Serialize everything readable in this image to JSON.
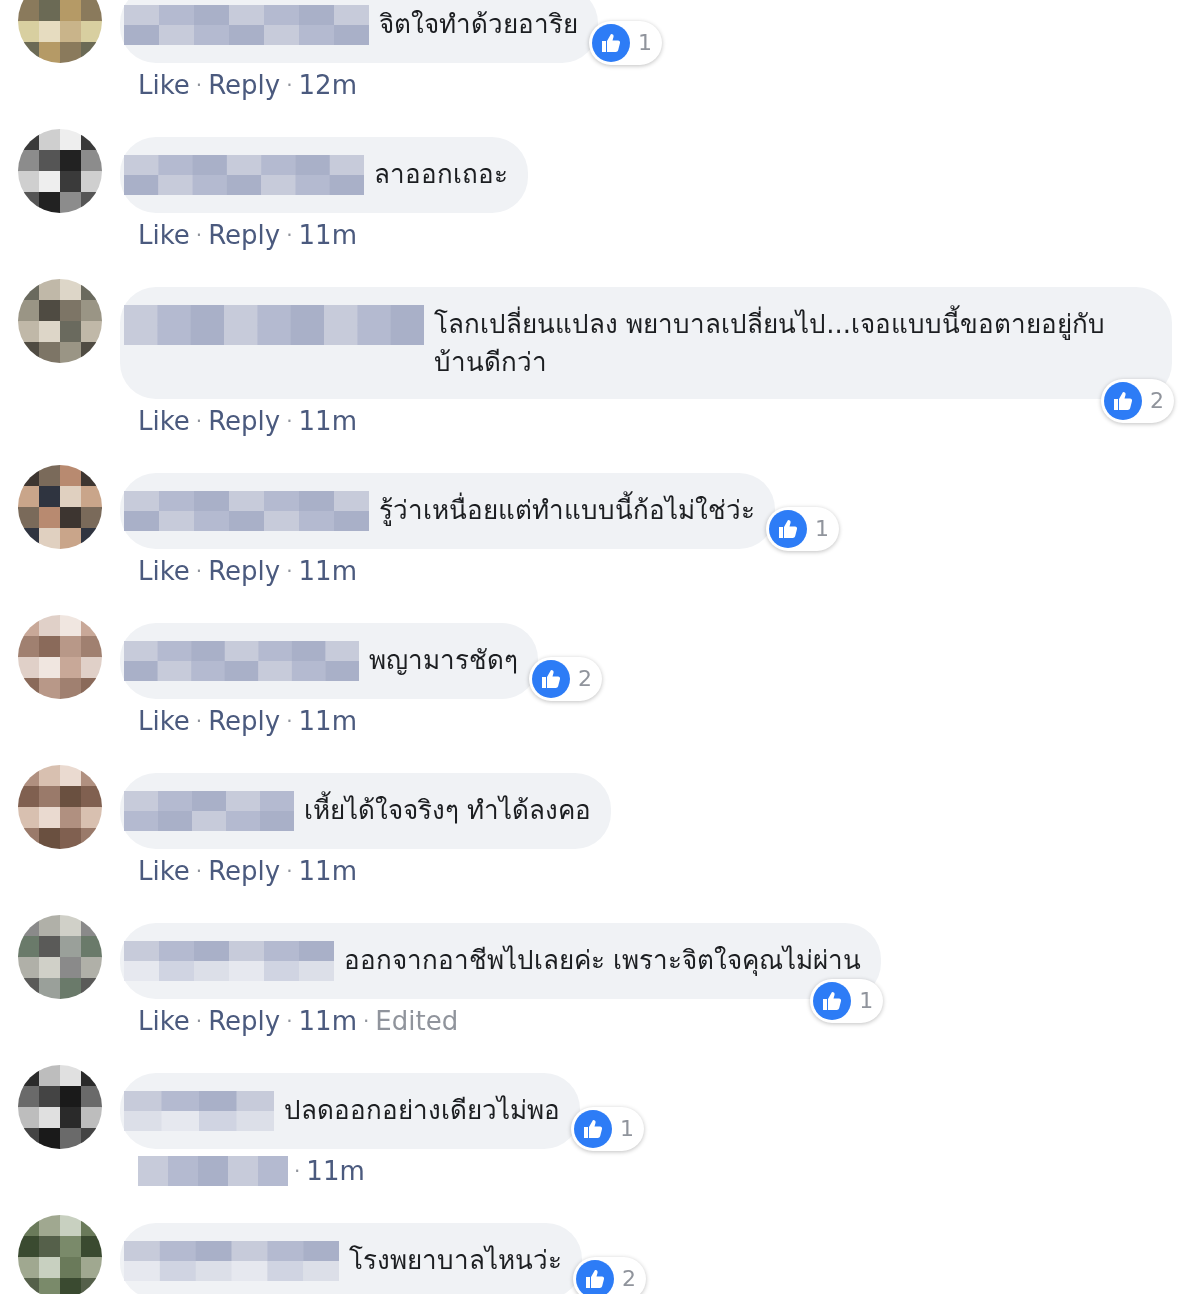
{
  "separator": "·",
  "comments": [
    {
      "text": "จิตใจทำด้วยอาริย",
      "reactions": {
        "count": "1"
      },
      "actions": [
        {
          "kind": "link",
          "label": "Like"
        },
        {
          "kind": "link",
          "label": "Reply"
        },
        {
          "kind": "time",
          "label": "12m"
        }
      ]
    },
    {
      "text": "ลาออกเถอะ",
      "actions": [
        {
          "kind": "link",
          "label": "Like"
        },
        {
          "kind": "link",
          "label": "Reply"
        },
        {
          "kind": "time",
          "label": "11m"
        }
      ]
    },
    {
      "text": "โลกเปลี่ยนแปลง พยาบาลเปลี่ยนไป...เจอแบบนี้ขอตายอยู่กับบ้านดีกว่า",
      "reactions": {
        "count": "2"
      },
      "actions": [
        {
          "kind": "link",
          "label": "Like"
        },
        {
          "kind": "link",
          "label": "Reply"
        },
        {
          "kind": "time",
          "label": "11m"
        }
      ]
    },
    {
      "text": "รู้ว่าเหนื่อยแต่ทำแบบนี้ก้อไม่ใช่ว่ะ",
      "reactions": {
        "count": "1"
      },
      "actions": [
        {
          "kind": "link",
          "label": "Like"
        },
        {
          "kind": "link",
          "label": "Reply"
        },
        {
          "kind": "time",
          "label": "11m"
        }
      ]
    },
    {
      "text": "พญามารชัดๆ",
      "reactions": {
        "count": "2"
      },
      "actions": [
        {
          "kind": "link",
          "label": "Like"
        },
        {
          "kind": "link",
          "label": "Reply"
        },
        {
          "kind": "time",
          "label": "11m"
        }
      ]
    },
    {
      "text": "เหี้ยได้ใจจริงๆ ทำได้ลงคอ",
      "actions": [
        {
          "kind": "link",
          "label": "Like"
        },
        {
          "kind": "link",
          "label": "Reply"
        },
        {
          "kind": "time",
          "label": "11m"
        }
      ]
    },
    {
      "text": "ออกจากอาชีพไปเลยค่ะ เพราะจิตใจคุณไม่ผ่าน",
      "reactions": {
        "count": "1"
      },
      "actions": [
        {
          "kind": "link",
          "label": "Like"
        },
        {
          "kind": "link",
          "label": "Reply"
        },
        {
          "kind": "time",
          "label": "11m"
        },
        {
          "kind": "edited",
          "label": "Edited"
        }
      ]
    },
    {
      "text": "ปลดออกอย่างเดียวไม่พอ",
      "reactions": {
        "count": "1"
      },
      "actions": [
        {
          "kind": "blurred"
        },
        {
          "kind": "time",
          "label": "11m"
        }
      ]
    },
    {
      "text": "โรงพยาบาลไหนว่ะ",
      "reactions": {
        "count": "2"
      }
    }
  ]
}
